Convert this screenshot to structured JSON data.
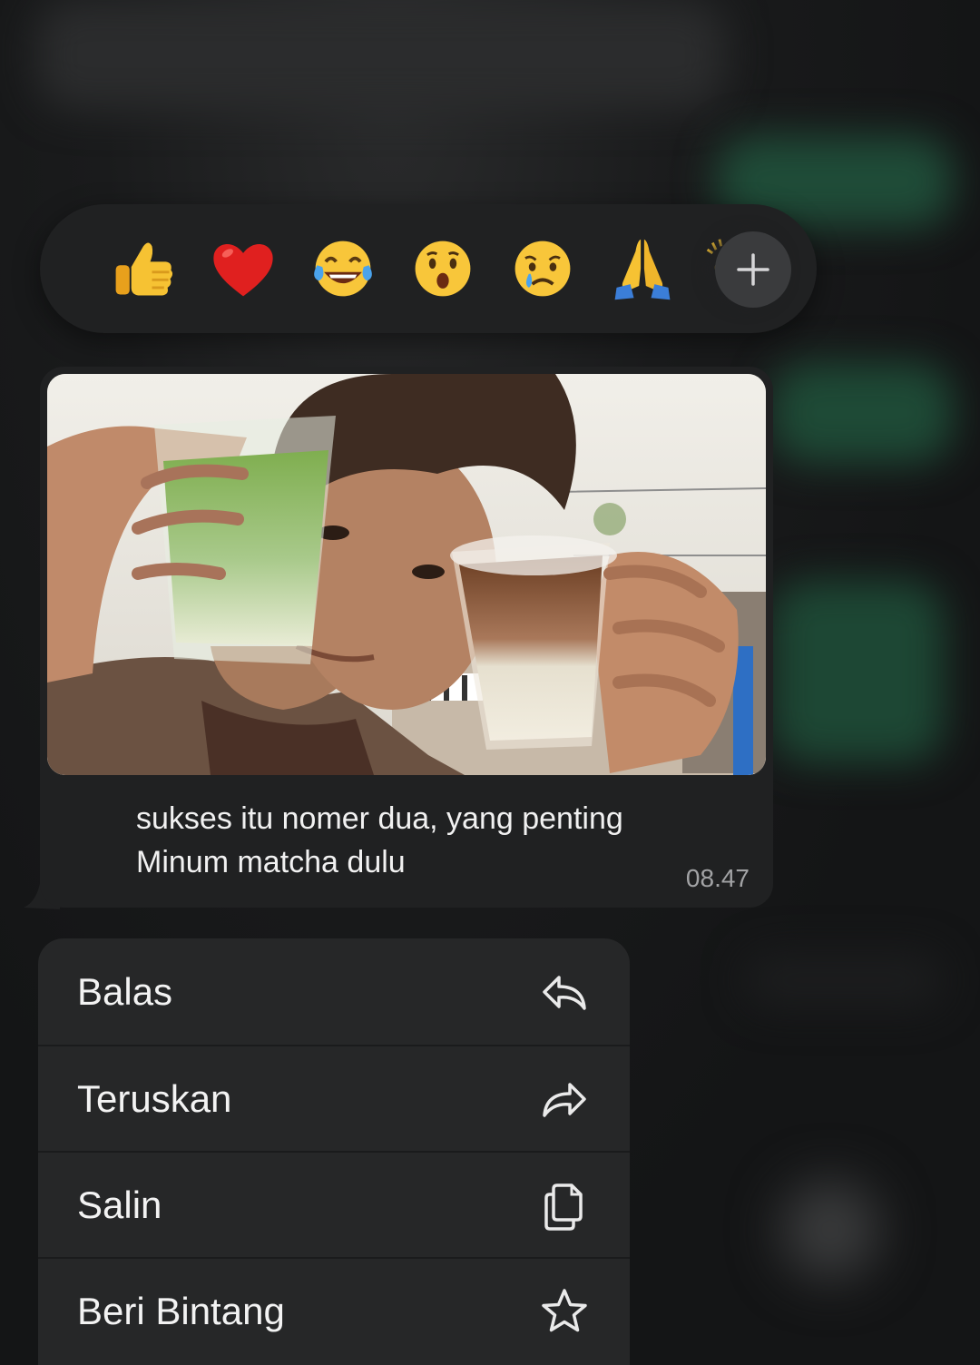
{
  "reactions": [
    {
      "icon": "thumbs-up-emoji"
    },
    {
      "icon": "red-heart-emoji"
    },
    {
      "icon": "face-with-tears-of-joy-emoji"
    },
    {
      "icon": "surprised-face-emoji"
    },
    {
      "icon": "crying-face-emoji"
    },
    {
      "icon": "folded-hands-emoji"
    },
    {
      "icon": "clapping-hands-emoji"
    }
  ],
  "add_reaction": {
    "icon": "plus-icon"
  },
  "message": {
    "caption_line1": "sukses itu nomer dua, yang penting",
    "caption_line2": "Minum matcha dulu",
    "time": "08.47"
  },
  "menu": {
    "items": [
      {
        "label": "Balas",
        "icon": "reply-icon"
      },
      {
        "label": "Teruskan",
        "icon": "forward-icon"
      },
      {
        "label": "Salin",
        "icon": "copy-icon"
      },
      {
        "label": "Beri Bintang",
        "icon": "star-icon"
      }
    ]
  },
  "colors": {
    "background": "#151617",
    "bubble": "#202122",
    "menu": "#262728",
    "text": "#f3f3f3",
    "timestamp": "#a2a3a5"
  }
}
